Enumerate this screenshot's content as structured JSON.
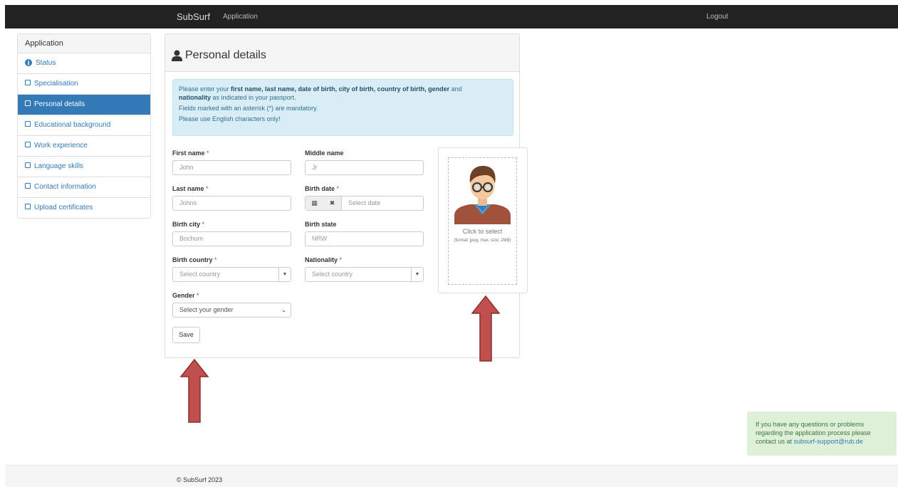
{
  "navbar": {
    "brand": "SubSurf",
    "application_link": "Application",
    "logout": "Logout"
  },
  "sidebar": {
    "title": "Application",
    "items": [
      {
        "label": "Status",
        "icon": "info-icon"
      },
      {
        "label": "Specialisation",
        "icon": "checkbox-icon"
      },
      {
        "label": "Personal details",
        "icon": "checkbox-icon",
        "active": true
      },
      {
        "label": "Educational background",
        "icon": "checkbox-icon"
      },
      {
        "label": "Work experience",
        "icon": "checkbox-icon"
      },
      {
        "label": "Language skills",
        "icon": "checkbox-icon"
      },
      {
        "label": "Contact information",
        "icon": "checkbox-icon"
      },
      {
        "label": "Upload certificates",
        "icon": "checkbox-icon"
      }
    ]
  },
  "panel": {
    "title": "Personal details",
    "alert": {
      "line1_pre": "Please enter your ",
      "line1_bold": "first name, last name, date of birth, city of birth, country of birth, gender",
      "line1_mid": " and",
      "line2_bold": "nationality",
      "line2_post": " as indicated in your passport.",
      "line3": "Fields marked with an asterisk (*) are mandatory.",
      "line4": "Please use English characters only!"
    }
  },
  "form": {
    "required_marker": "*",
    "first_name": {
      "label": "First name",
      "placeholder": "John"
    },
    "middle_name": {
      "label": "Middle name",
      "placeholder": "Jr"
    },
    "last_name": {
      "label": "Last name",
      "placeholder": "Johns"
    },
    "birth_date": {
      "label": "Birth date",
      "placeholder": "Select date"
    },
    "birth_city": {
      "label": "Birth city",
      "placeholder": "Bochum"
    },
    "birth_state": {
      "label": "Birth state",
      "placeholder": "NRW"
    },
    "birth_country": {
      "label": "Birth country",
      "placeholder": "Select country"
    },
    "nationality": {
      "label": "Nationality",
      "placeholder": "Select country"
    },
    "gender": {
      "label": "Gender",
      "placeholder": "Select your gender"
    },
    "save": "Save"
  },
  "photo": {
    "click_text": "Click to select",
    "hint": "(format: jpeg, max. size: 2MB)"
  },
  "help": {
    "text": "If you have any questions or problems regarding the application process please contact us at ",
    "email": "subsurf-support@rub.de"
  },
  "footer": {
    "text": "© SubSurf 2023"
  },
  "colors": {
    "navbar": "#222222",
    "primary": "#337ab7",
    "alert_bg": "#d9edf7",
    "help_bg": "#dff0d8",
    "arrow": "#c0504d"
  }
}
